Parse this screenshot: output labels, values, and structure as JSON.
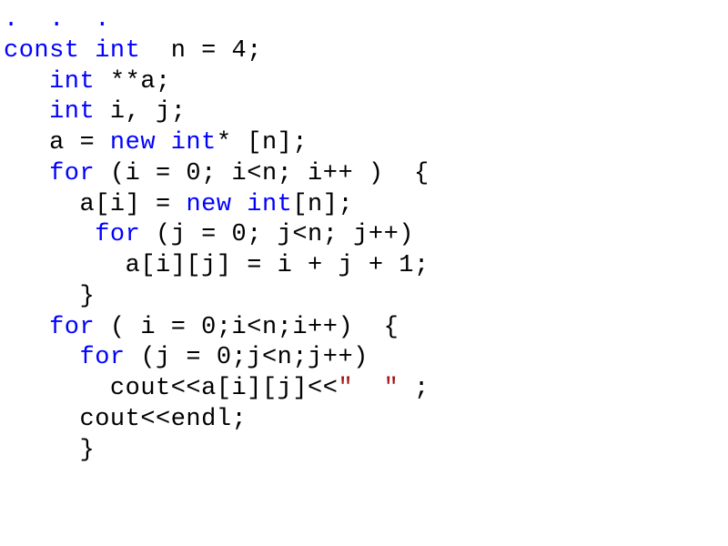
{
  "code": {
    "l1": ".  .  .",
    "l2a": "const int",
    "l2b": "  n = 4;",
    "l3a": "   int",
    "l3b": " **a;",
    "l4a": "   int",
    "l4b": " i, j;",
    "l5a": "   a = ",
    "l5b": "new int",
    "l5c": "* [n];",
    "l6a": "   for",
    "l6b": " (i = 0; i<n; i++ )  {",
    "l7a": "     a[i] = ",
    "l7b": "new int",
    "l7c": "[n];",
    "l8a": "      for",
    "l8b": " (j = 0; j<n; j++)",
    "l9": "        a[i][j] = i + j + 1;",
    "l10": "     }",
    "l11a": "   for",
    "l11b": " ( i = 0;i<n;i++)  {",
    "l12a": "     for",
    "l12b": " (j = 0;j<n;j++)",
    "l13a": "       cout<<a[i][j]<<",
    "l13b": "\"  \"",
    "l13c": " ;",
    "l14": "     cout<<endl;",
    "l15": "     }"
  }
}
